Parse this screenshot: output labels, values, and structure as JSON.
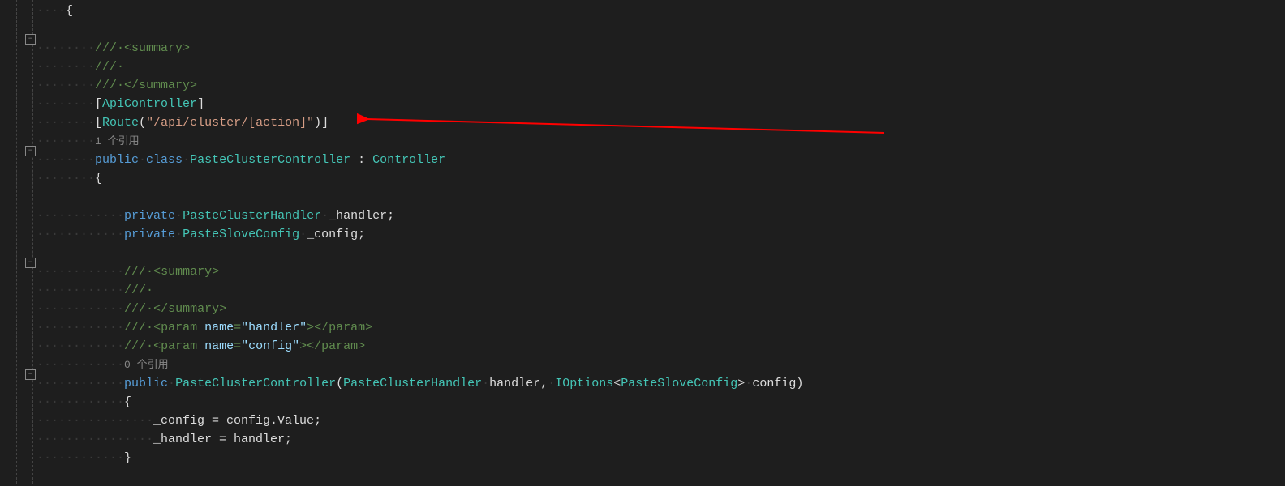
{
  "code": {
    "brace_open": "{",
    "brace_close": "}",
    "summary_open": "<summary>",
    "summary_blank": "",
    "summary_close": "</summary>",
    "attr_api": "ApiController",
    "attr_route_name": "Route",
    "attr_route_arg": "\"/api/cluster/[action]\"",
    "codelens_1": "1 个引用",
    "codelens_0": "0 个引用",
    "kw_public": "public",
    "kw_class": "class",
    "kw_private": "private",
    "cls_name": "PasteClusterController",
    "base_cls": "Controller",
    "type_handler": "PasteClusterHandler",
    "field_handler": "_handler",
    "type_config": "PasteSloveConfig",
    "field_config": "_config",
    "type_ioptions": "IOptions",
    "param_tag_open": "<param ",
    "param_name_attr": "name",
    "param_handler_val": "\"handler\"",
    "param_config_val": "\"config\"",
    "param_tag_close": "></param>",
    "ctor_param_handler": "handler",
    "ctor_param_config": "config",
    "assign_config": "_config = config.Value;",
    "assign_handler": "_handler = handler;",
    "semicolon": ";",
    "triple_slash": "///"
  }
}
